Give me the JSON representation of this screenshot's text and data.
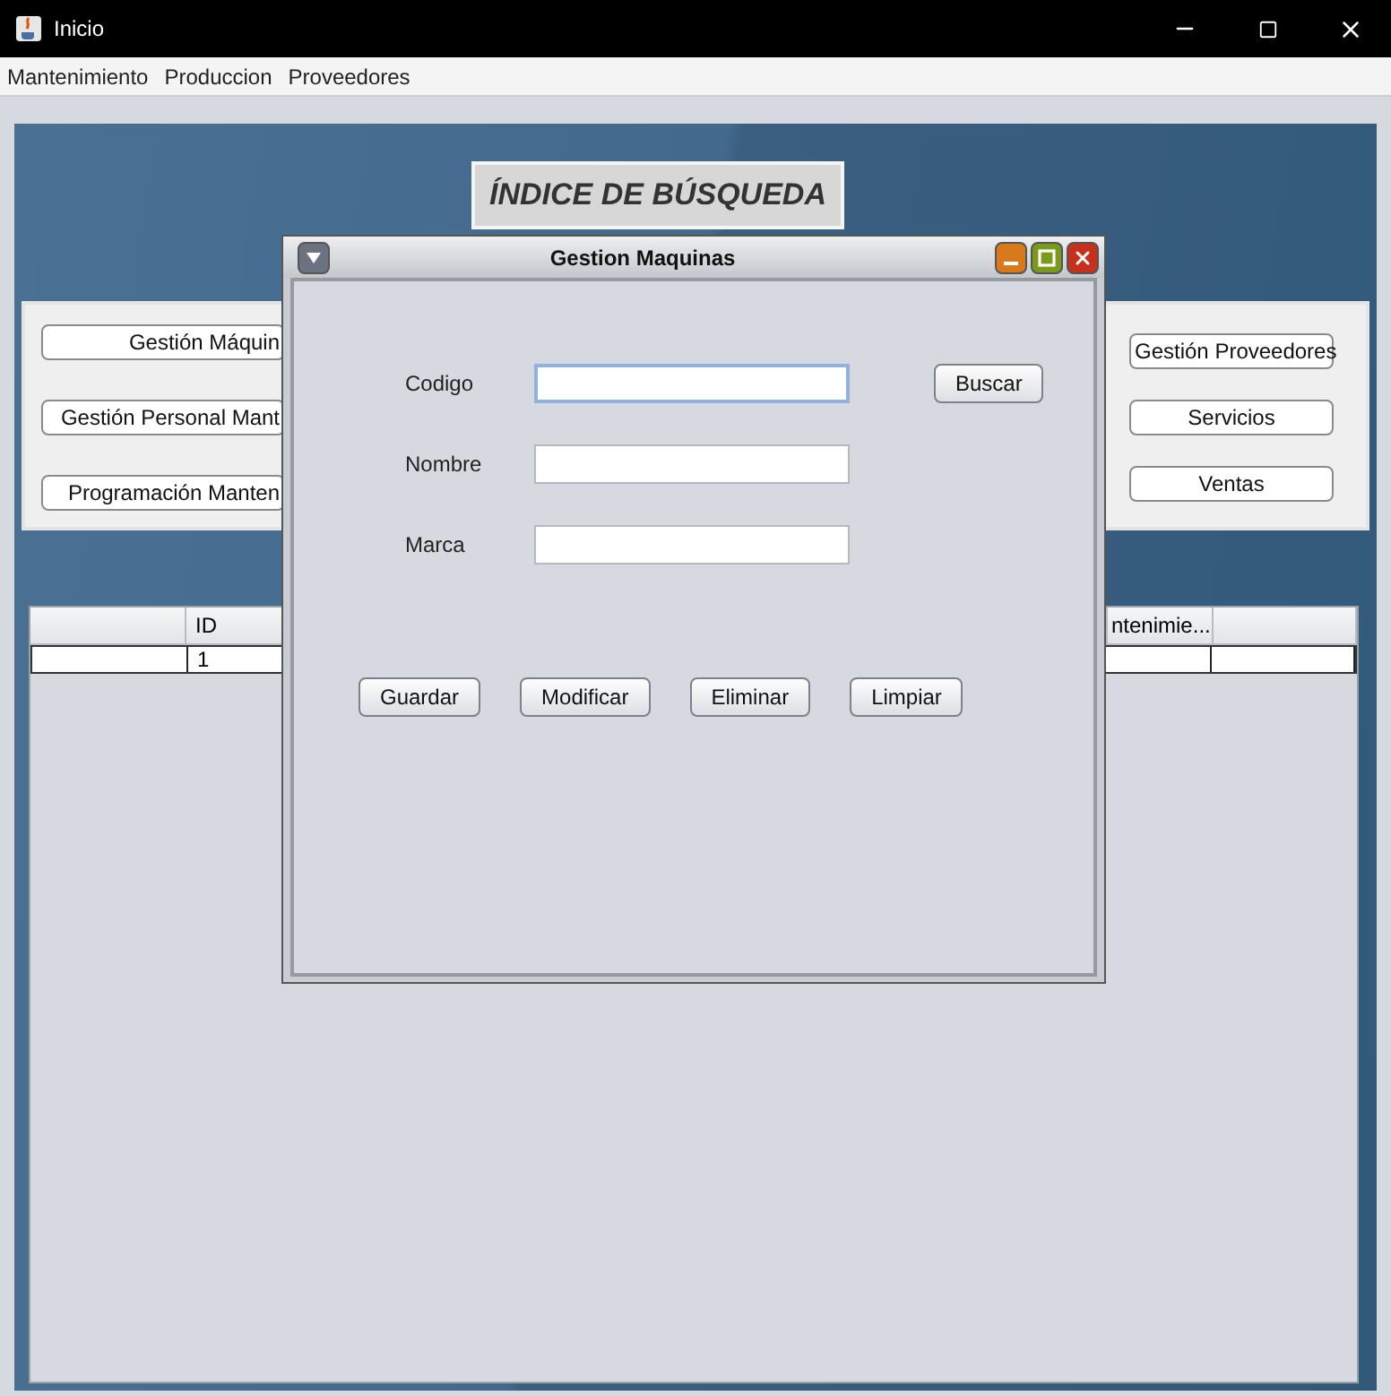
{
  "window": {
    "title": "Inicio"
  },
  "menu": [
    "Mantenimiento",
    "Produccion",
    "Proveedores"
  ],
  "main": {
    "heading": "ÍNDICE DE BÚSQUEDA",
    "left_buttons": [
      "Gestión Máquin",
      "Gestión Personal  Mant",
      "Programación Manten"
    ],
    "right_buttons": [
      "Gestión Proveedores",
      "Servicios",
      "Ventas"
    ],
    "table": {
      "columns": [
        "ID",
        "ntenimie..."
      ],
      "rows": [
        {
          "id": "1"
        }
      ]
    }
  },
  "dialog": {
    "title": "Gestion Maquinas",
    "fields": [
      {
        "label": "Codigo",
        "focused": true
      },
      {
        "label": "Nombre",
        "focused": false
      },
      {
        "label": "Marca",
        "focused": false
      }
    ],
    "search_button": "Buscar",
    "buttons": [
      "Guardar",
      "Modificar",
      "Eliminar",
      "Limpiar"
    ]
  }
}
